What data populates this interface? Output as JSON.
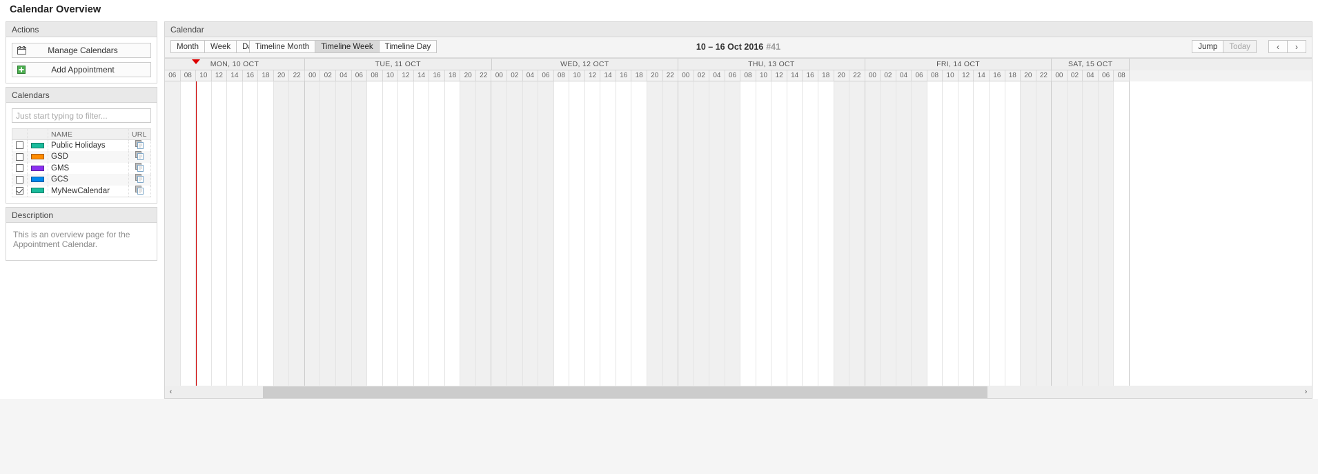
{
  "page": {
    "title": "Calendar Overview"
  },
  "actions": {
    "header": "Actions",
    "items": [
      {
        "label": "Manage Calendars",
        "icon": "calendar-icon"
      },
      {
        "label": "Add Appointment",
        "icon": "plus-icon"
      }
    ]
  },
  "calendars": {
    "header": "Calendars",
    "filter_placeholder": "Just start typing to filter...",
    "filter_value": "",
    "columns": [
      "",
      "",
      "NAME",
      "URL"
    ],
    "rows": [
      {
        "name": "Public Holidays",
        "color": "#1abc9c",
        "checked": false,
        "url_icon": "copy-icon"
      },
      {
        "name": "GSD",
        "color": "#ff8c00",
        "checked": false,
        "url_icon": "copy-icon"
      },
      {
        "name": "GMS",
        "color": "#8b30f0",
        "checked": false,
        "url_icon": "copy-icon"
      },
      {
        "name": "GCS",
        "color": "#0088ee",
        "checked": false,
        "url_icon": "copy-icon"
      },
      {
        "name": "MyNewCalendar",
        "color": "#1abc9c",
        "checked": true,
        "url_icon": "copy-icon"
      }
    ]
  },
  "description": {
    "header": "Description",
    "text": "This is an overview page for the Appointment Calendar."
  },
  "calendar_panel": {
    "header": "Calendar",
    "views_basic": [
      {
        "label": "Month",
        "active": false
      },
      {
        "label": "Week",
        "active": false
      },
      {
        "label": "Day",
        "active": false
      }
    ],
    "views_timeline": [
      {
        "label": "Timeline Month",
        "active": false
      },
      {
        "label": "Timeline Week",
        "active": true
      },
      {
        "label": "Timeline Day",
        "active": false
      }
    ],
    "title": "10 – 16 Oct 2016",
    "week_number": "#41",
    "jump_label": "Jump",
    "today_label": "Today",
    "today_disabled": true,
    "prev_label": "‹",
    "next_label": "›",
    "scroll_left_label": "‹",
    "scroll_right_label": "›"
  },
  "timeline": {
    "hour_step": 2,
    "now_color": "#cc0000",
    "days": [
      {
        "label": "MON, 10 OCT",
        "hours": [
          "06",
          "08",
          "10",
          "12",
          "14",
          "16",
          "18",
          "20",
          "22"
        ]
      },
      {
        "label": "TUE, 11 OCT",
        "hours": [
          "00",
          "02",
          "04",
          "06",
          "08",
          "10",
          "12",
          "14",
          "16",
          "18",
          "20",
          "22"
        ]
      },
      {
        "label": "WED, 12 OCT",
        "hours": [
          "00",
          "02",
          "04",
          "06",
          "08",
          "10",
          "12",
          "14",
          "16",
          "18",
          "20",
          "22"
        ]
      },
      {
        "label": "THU, 13 OCT",
        "hours": [
          "00",
          "02",
          "04",
          "06",
          "08",
          "10",
          "12",
          "14",
          "16",
          "18",
          "20",
          "22"
        ]
      },
      {
        "label": "FRI, 14 OCT",
        "hours": [
          "00",
          "02",
          "04",
          "06",
          "08",
          "10",
          "12",
          "14",
          "16",
          "18",
          "20",
          "22"
        ]
      },
      {
        "label": "SAT, 15 OCT",
        "hours": [
          "00",
          "02",
          "04",
          "06",
          "08"
        ]
      }
    ],
    "now_day_index": 0,
    "now_hour_index": 2
  }
}
